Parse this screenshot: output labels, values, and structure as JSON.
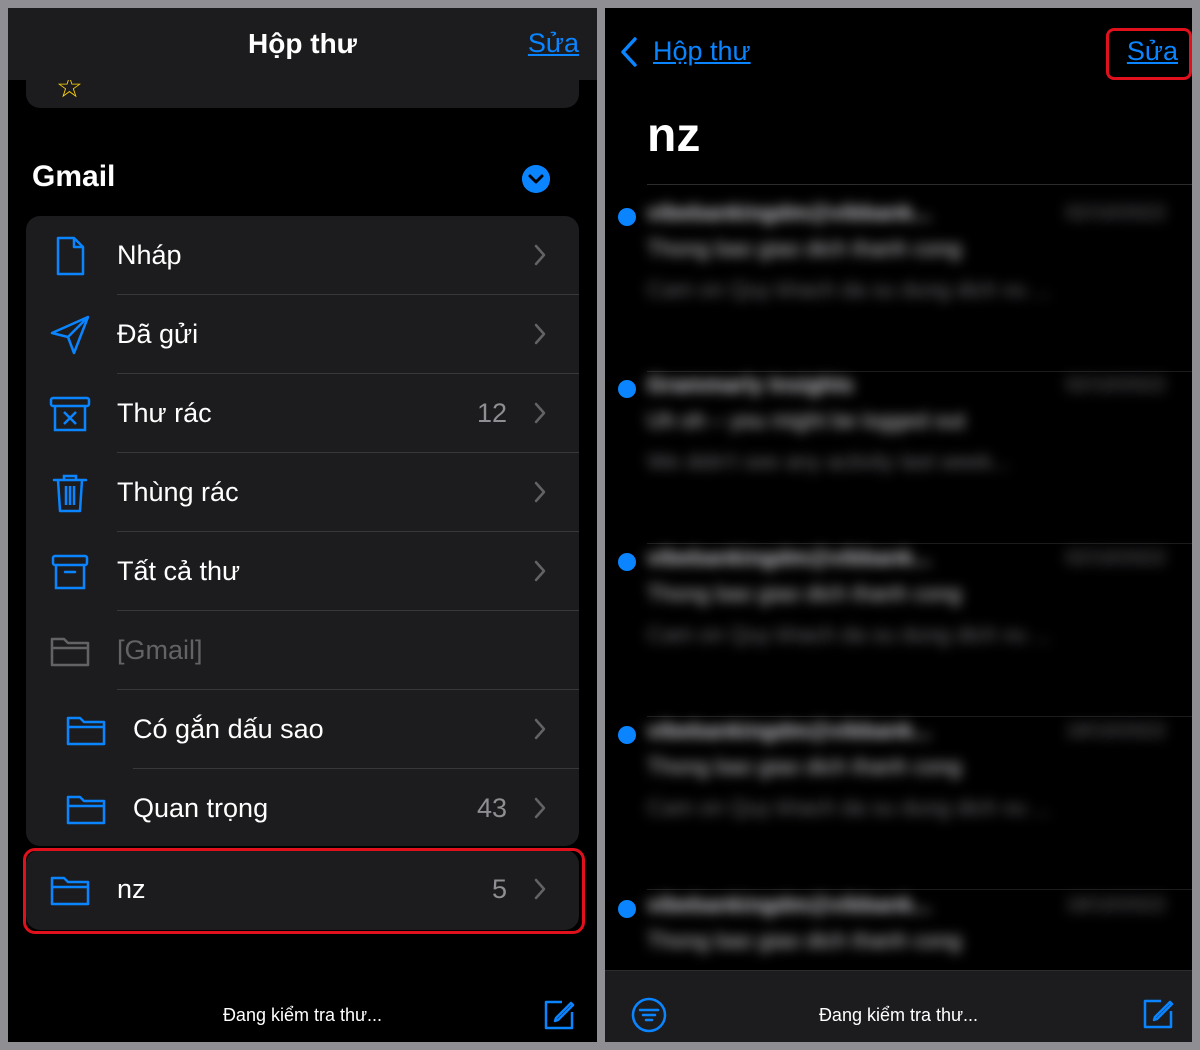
{
  "left": {
    "nav_title": "Hộp thư",
    "edit_label": "Sửa",
    "account_section": "Gmail",
    "folders": [
      {
        "label": "Nháp",
        "count": "",
        "icon": "doc-icon"
      },
      {
        "label": "Đã gửi",
        "count": "",
        "icon": "paperplane-icon"
      },
      {
        "label": "Thư rác",
        "count": "12",
        "icon": "junk-icon"
      },
      {
        "label": "Thùng rác",
        "count": "",
        "icon": "trash-icon"
      },
      {
        "label": "Tất cả thư",
        "count": "",
        "icon": "archive-icon"
      },
      {
        "label": "[Gmail]",
        "count": "",
        "icon": "folder-icon"
      },
      {
        "label": "Có gắn dấu sao",
        "count": "",
        "icon": "folder-icon"
      },
      {
        "label": "Quan trọng",
        "count": "43",
        "icon": "folder-icon"
      }
    ],
    "nz_folder": {
      "label": "nz",
      "count": "5",
      "icon": "folder-icon"
    },
    "status": "Đang kiểm tra thư..."
  },
  "right": {
    "back_label": "Hộp thư",
    "edit_label": "Sửa",
    "mailbox_title": "nz",
    "messages": [
      {
        "sender": "vibebankingdm@vibbank...",
        "date": "02/10/2022",
        "subject": "Thong bao giao dich thanh cong",
        "preview": "Cam on Quy khach da su dung dich vu ..."
      },
      {
        "sender": "Grammarly Insights",
        "date": "02/10/2022",
        "subject": "Uh oh – you might be logged out",
        "preview": "We didn't see any activity last week..."
      },
      {
        "sender": "vibebankingdm@vibbank...",
        "date": "02/10/2022",
        "subject": "Thong bao giao dich thanh cong",
        "preview": "Cam on Quy khach da su dung dich vu ..."
      },
      {
        "sender": "vibebankingdm@vibbank...",
        "date": "18/10/2022",
        "subject": "Thong bao giao dich thanh cong",
        "preview": "Cam on Quy khach da su dung dich vu ..."
      },
      {
        "sender": "vibebankingdm@vibbank...",
        "date": "18/10/2022",
        "subject": "Thong bao giao dich thanh cong",
        "preview": ""
      }
    ],
    "status": "Đang kiểm tra thư..."
  },
  "colors": {
    "accent": "#0a84ff",
    "highlight": "#e0101c",
    "background": "#000000",
    "card": "#1c1c1e"
  }
}
